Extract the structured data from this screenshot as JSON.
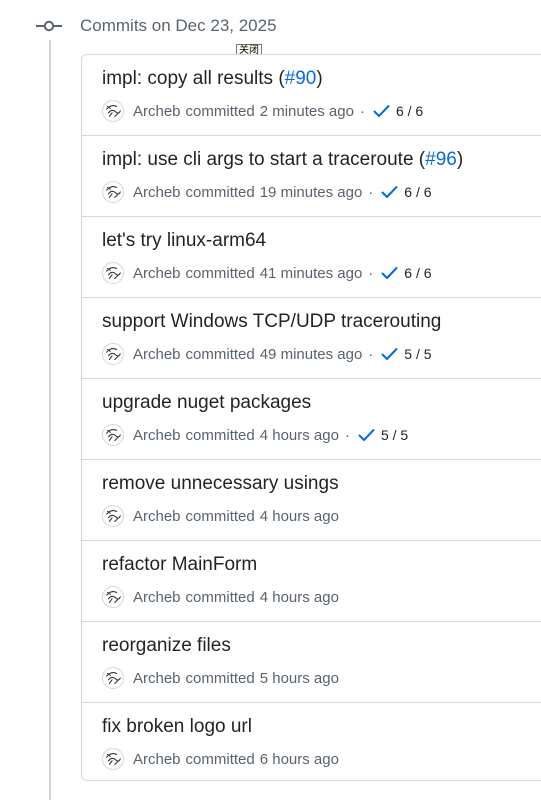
{
  "header": {
    "title": "Commits on Dec 23, 2025",
    "tooltip": "关闭"
  },
  "colors": {
    "link": "#0969da",
    "check": "#0969da",
    "muted": "#59636e",
    "border": "#d0d7de"
  },
  "commits": [
    {
      "title": "impl: copy all results (",
      "pr": "#90",
      "suffix": ")",
      "author": "Archeb",
      "verb": "committed",
      "time": "2 minutes ago",
      "checks": "6 / 6"
    },
    {
      "title": "impl: use cli args to start a traceroute (",
      "pr": "#96",
      "suffix": ")",
      "author": "Archeb",
      "verb": "committed",
      "time": "19 minutes ago",
      "checks": "6 / 6"
    },
    {
      "title": "let's try linux-arm64",
      "pr": "",
      "suffix": "",
      "author": "Archeb",
      "verb": "committed",
      "time": "41 minutes ago",
      "checks": "6 / 6"
    },
    {
      "title": "support Windows TCP/UDP tracerouting",
      "pr": "",
      "suffix": "",
      "author": "Archeb",
      "verb": "committed",
      "time": "49 minutes ago",
      "checks": "5 / 5"
    },
    {
      "title": "upgrade nuget packages",
      "pr": "",
      "suffix": "",
      "author": "Archeb",
      "verb": "committed",
      "time": "4 hours ago",
      "checks": "5 / 5"
    },
    {
      "title": "remove unnecessary usings",
      "pr": "",
      "suffix": "",
      "author": "Archeb",
      "verb": "committed",
      "time": "4 hours ago",
      "checks": ""
    },
    {
      "title": "refactor MainForm",
      "pr": "",
      "suffix": "",
      "author": "Archeb",
      "verb": "committed",
      "time": "4 hours ago",
      "checks": ""
    },
    {
      "title": "reorganize files",
      "pr": "",
      "suffix": "",
      "author": "Archeb",
      "verb": "committed",
      "time": "5 hours ago",
      "checks": ""
    },
    {
      "title": "fix broken logo url",
      "pr": "",
      "suffix": "",
      "author": "Archeb",
      "verb": "committed",
      "time": "6 hours ago",
      "checks": ""
    }
  ]
}
